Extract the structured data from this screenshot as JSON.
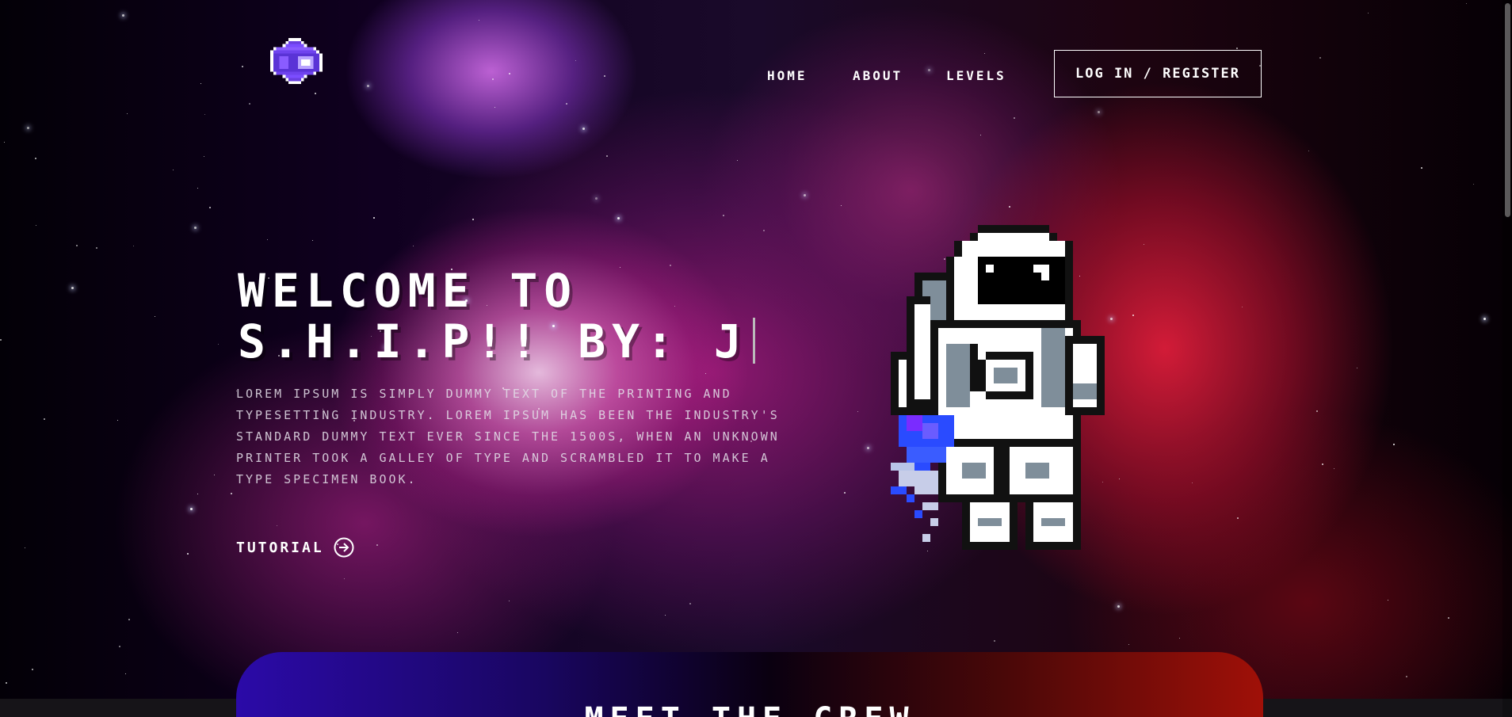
{
  "nav": {
    "links": [
      "HOME",
      "ABOUT",
      "LEVELS"
    ],
    "login_label": "LOG IN / REGISTER"
  },
  "hero": {
    "title_line1": "WELCOME TO",
    "title_line2": "S.H.I.P!! BY: J",
    "description": "LOREM IPSUM IS SIMPLY DUMMY TEXT OF THE PRINTING AND TYPESETTING INDUSTRY. LOREM IPSUM HAS BEEN THE INDUSTRY'S STANDARD DUMMY TEXT EVER SINCE THE 1500S, WHEN AN UNKNOWN PRINTER TOOK A GALLEY OF TYPE AND SCRAMBLED IT TO MAKE A TYPE SPECIMEN BOOK.",
    "tutorial_label": "TUTORIAL"
  },
  "crew": {
    "title": "MEET THE CREW"
  },
  "icons": {
    "logo": "pixel-spaceship-icon",
    "tutorial": "circle-arrow-right-icon",
    "hero_art": "pixel-astronaut-icon"
  },
  "colors": {
    "accent_blue": "#2b0aa8",
    "accent_red": "#a01008",
    "text": "#ffffff"
  }
}
